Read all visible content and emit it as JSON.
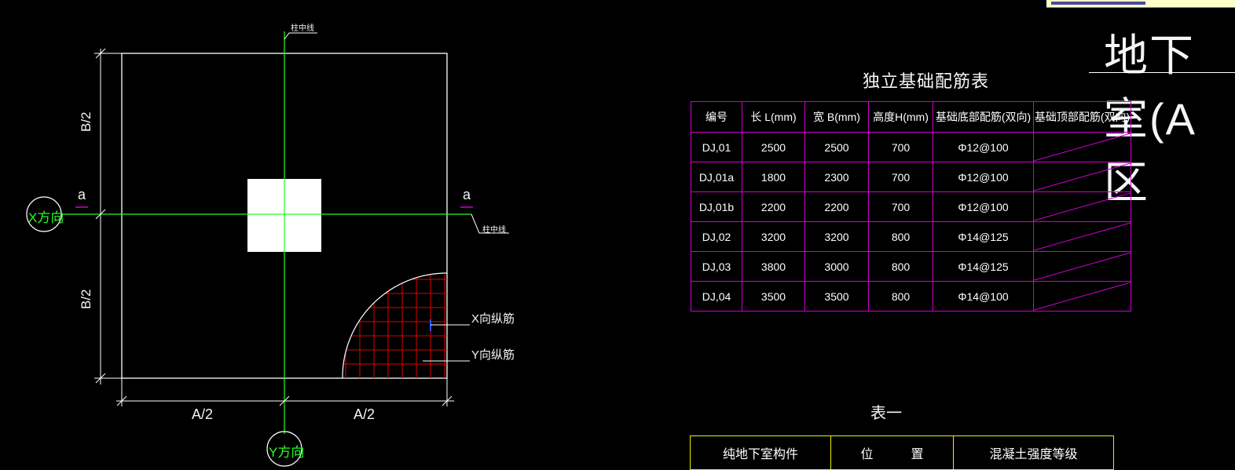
{
  "drawing": {
    "col_center_label": "柱中线",
    "x_direction": "X方向",
    "y_direction": "Y方向",
    "a_mark": "a",
    "b_half": "B/2",
    "a_half": "A/2",
    "x_rebar": "X向纵筋",
    "y_rebar": "Y向纵筋"
  },
  "header": {
    "title": "地下室(A区"
  },
  "rebar_table": {
    "title": "独立基础配筋表",
    "headers": [
      "编号",
      "长 L(mm)",
      "宽 B(mm)",
      "高度H(mm)",
      "基础底部配筋(双向)",
      "基础顶部配筋(双向)"
    ],
    "rows": [
      [
        "DJ,01",
        "2500",
        "2500",
        "700",
        "Φ12@100"
      ],
      [
        "DJ,01a",
        "1800",
        "2300",
        "700",
        "Φ12@100"
      ],
      [
        "DJ,01b",
        "2200",
        "2200",
        "700",
        "Φ12@100"
      ],
      [
        "DJ,02",
        "3200",
        "3200",
        "800",
        "Φ14@125"
      ],
      [
        "DJ,03",
        "3800",
        "3000",
        "800",
        "Φ14@125"
      ],
      [
        "DJ,04",
        "3500",
        "3500",
        "800",
        "Φ14@100"
      ]
    ]
  },
  "table_one": {
    "title": "表一",
    "headers": [
      "纯地下室构件",
      "位　　　置",
      "混凝土强度等级"
    ]
  },
  "colors": {
    "outline": "#ffffff",
    "axis": "#20ff20",
    "table_border": "#d000d0",
    "rebar": "#e00000",
    "table_one_border": "#f0f000"
  }
}
